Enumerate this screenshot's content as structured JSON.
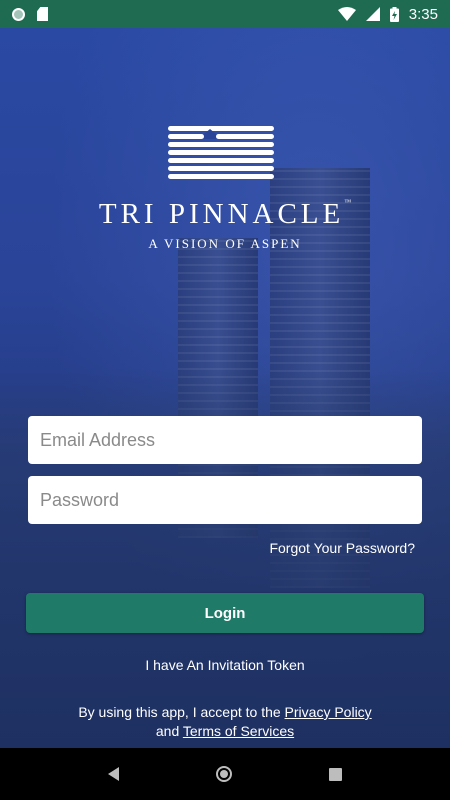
{
  "status_bar": {
    "time": "3:35",
    "icons": [
      "circle-notification-icon",
      "sd-card-icon",
      "wifi-icon",
      "cellular-signal-icon",
      "battery-charging-icon"
    ]
  },
  "brand": {
    "name": "TRI PINNACLE",
    "trademark": "™",
    "tagline": "A VISION OF ASPEN",
    "logo_icon": "tri-pinnacle-logo-icon"
  },
  "form": {
    "email_placeholder": "Email Address",
    "password_placeholder": "Password",
    "forgot_label": "Forgot Your Password?",
    "login_label": "Login",
    "invitation_label": "I have An Invitation Token"
  },
  "legal": {
    "prefix": "By using this app, I accept to the ",
    "privacy_link": "Privacy Policy",
    "and": "and ",
    "terms_link": "Terms of Services"
  },
  "nav": {
    "icons": [
      "back-icon",
      "home-icon",
      "recents-icon"
    ]
  },
  "colors": {
    "status_bar": "#1e6b52",
    "background": "#2a4498",
    "login_button": "#1f7a68",
    "nav_bar": "#000000"
  }
}
